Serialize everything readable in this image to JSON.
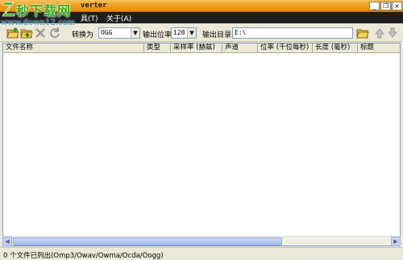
{
  "window": {
    "title": "verter",
    "controls": {
      "minimize": "_",
      "restore": "❐",
      "close": "×"
    }
  },
  "watermark": {
    "brand": "秒下载网",
    "url": "www.down12.com"
  },
  "menu": {
    "tools": "具(T)",
    "about": "关于(A)"
  },
  "toolbar": {
    "convert_to_label": "转换为",
    "format_value": "OGG",
    "bitrate_label": "输出位率",
    "bitrate_value": "128",
    "output_dir_label": "输出目录",
    "output_dir_value": "E:\\"
  },
  "list": {
    "columns": [
      "文件名称",
      "类型",
      "采样率 (赫兹)",
      "声道",
      "位率 (千位每秒)",
      "长度 (毫秒)",
      "标题"
    ]
  },
  "status": {
    "text": "0 个文件已列出(Omp3/Owav/Owma/Ocda/Oogg)"
  },
  "colors": {
    "titlebar": "#f0a020",
    "menubar": "#1e1e1e",
    "watermark_green": "#3aa81c",
    "watermark_blue": "#2c8fc9"
  }
}
